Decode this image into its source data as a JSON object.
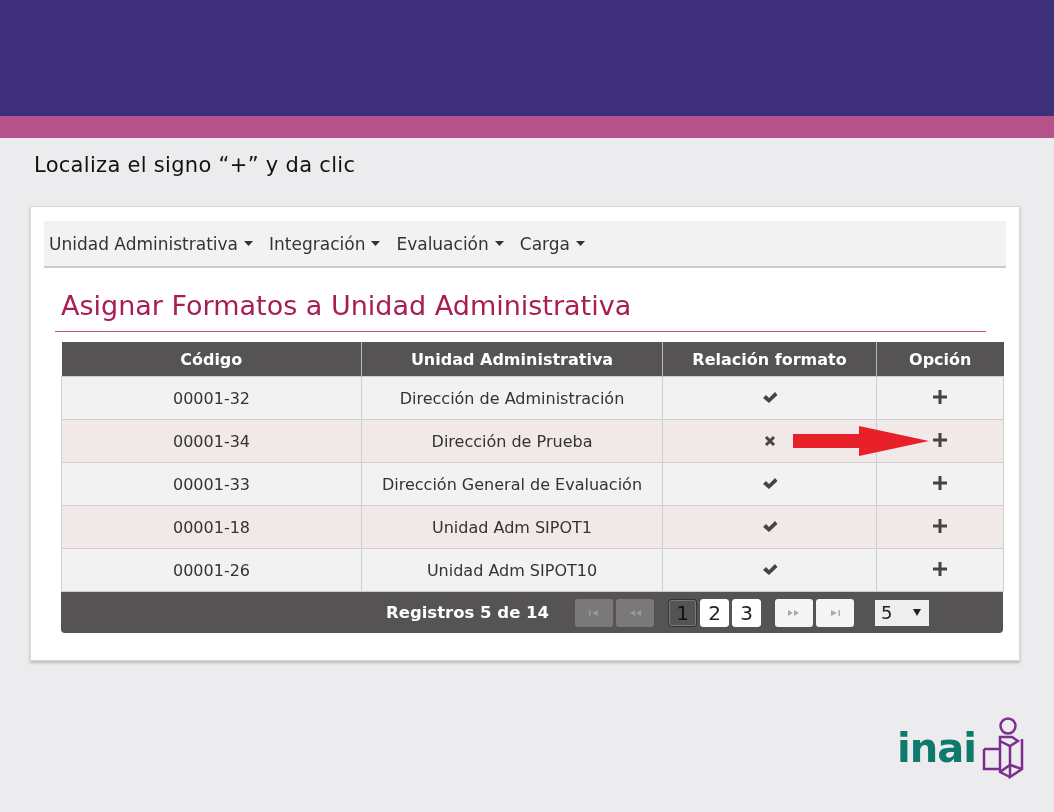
{
  "instruction": "Localiza el signo “+” y da clic",
  "nav": [
    {
      "label": "Unidad Administrativa"
    },
    {
      "label": "Integración"
    },
    {
      "label": "Evaluación"
    },
    {
      "label": "Carga"
    }
  ],
  "page_title": "Asignar Formatos a Unidad Administrativa",
  "table": {
    "columns": [
      "Código",
      "Unidad Administrativa",
      "Relación formato",
      "Opción"
    ],
    "rows": [
      {
        "code": "00001-32",
        "unit": "Dirección de Administración",
        "related": true,
        "arrow": false
      },
      {
        "code": "00001-34",
        "unit": "Dirección de Prueba",
        "related": false,
        "arrow": true
      },
      {
        "code": "00001-33",
        "unit": "Dirección General de Evaluación",
        "related": true,
        "arrow": false
      },
      {
        "code": "00001-18",
        "unit": "Unidad Adm SIPOT1",
        "related": true,
        "arrow": false
      },
      {
        "code": "00001-26",
        "unit": "Unidad Adm SIPOT10",
        "related": true,
        "arrow": false
      }
    ],
    "footer": {
      "records": "Registros 5 de 14",
      "nav_buttons": [
        {
          "kind": "first",
          "disabled": true
        },
        {
          "kind": "prev",
          "disabled": true
        },
        {
          "kind": "next",
          "disabled": false
        },
        {
          "kind": "last",
          "disabled": false
        }
      ],
      "pages": [
        {
          "label": "1",
          "selected": true
        },
        {
          "label": "2",
          "selected": false
        },
        {
          "label": "3",
          "selected": false
        }
      ],
      "page_size": "5"
    }
  },
  "logo": {
    "text": "inai"
  }
}
